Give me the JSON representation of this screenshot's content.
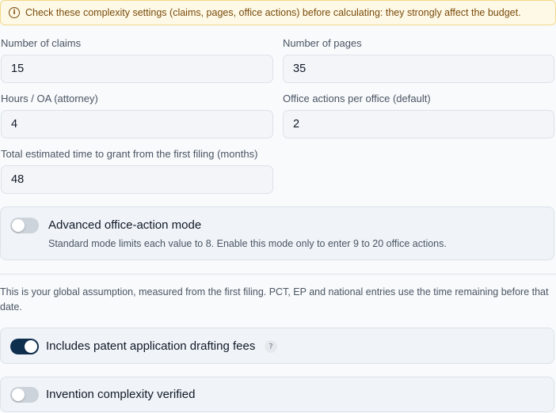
{
  "alert": {
    "icon": "info-icon",
    "text": "Check these complexity settings (claims, pages, office actions) before calculating: they strongly affect the budget."
  },
  "fields": {
    "claims": {
      "label": "Number of claims",
      "value": "15"
    },
    "pages": {
      "label": "Number of pages",
      "value": "35"
    },
    "hours_oa": {
      "label": "Hours / OA (attorney)",
      "value": "4"
    },
    "office_actions": {
      "label": "Office actions per office (default)",
      "value": "2"
    },
    "time_to_grant": {
      "label": "Total estimated time to grant from the first filing (months)",
      "value": "48"
    }
  },
  "advanced_mode": {
    "title": "Advanced office-action mode",
    "description": "Standard mode limits each value to 8. Enable this mode only to enter 9 to 20 office actions.",
    "enabled": false
  },
  "note": "This is your global assumption, measured from the first filing. PCT, EP and national entries use the time remaining before that date.",
  "drafting_fees": {
    "label": "Includes patent application drafting fees",
    "enabled": true,
    "help_icon": "question-icon",
    "help_glyph": "?"
  },
  "complexity_verified": {
    "label": "Invention complexity verified",
    "enabled": false
  },
  "colors": {
    "toggle_on": "#0f2f4f",
    "toggle_off": "#cdd3da",
    "alert_bg": "#fef9e6",
    "alert_text": "#7a4b0c"
  }
}
